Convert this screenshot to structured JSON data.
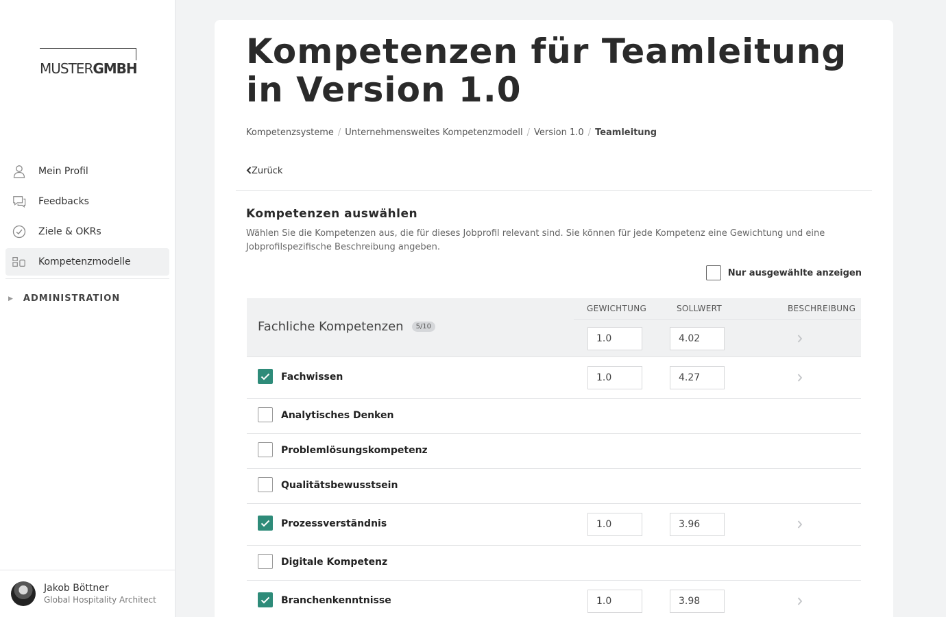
{
  "logo": {
    "part1": "MUSTER",
    "part2": "GMBH"
  },
  "nav": {
    "items": [
      {
        "label": "Mein Profil",
        "icon": "user-icon",
        "active": false
      },
      {
        "label": "Feedbacks",
        "icon": "chat-icon",
        "active": false
      },
      {
        "label": "Ziele & OKRs",
        "icon": "check-circle-icon",
        "active": false
      },
      {
        "label": "Kompetenzmodelle",
        "icon": "model-icon",
        "active": true
      }
    ],
    "admin_label": "ADMINISTRATION"
  },
  "user": {
    "name": "Jakob Böttner",
    "role": "Global Hospitality Architect"
  },
  "page": {
    "title": "Kompetenzen für Teamleitung in Version 1.0",
    "breadcrumb": [
      "Kompetenzsysteme",
      "Unternehmensweites Kompetenzmodell",
      "Version 1.0",
      "Teamleitung"
    ],
    "back_label": "Zurück",
    "section_title": "Kompetenzen auswählen",
    "section_desc": "Wählen Sie die Kompetenzen aus, die für dieses Jobprofil relevant sind. Sie können für jede Kompetenz eine Gewichtung und eine Jobprofilspezifische Beschreibung angeben.",
    "filter_label": "Nur ausgewählte anzeigen"
  },
  "table": {
    "columns": {
      "weight": "GEWICHTUNG",
      "target": "SOLLWERT",
      "desc": "BESCHREIBUNG"
    },
    "group": {
      "name": "Fachliche Kompetenzen",
      "badge": "5/10",
      "weight": "1.0",
      "target": "4.02"
    },
    "rows": [
      {
        "label": "Fachwissen",
        "checked": true,
        "weight": "1.0",
        "target": "4.27"
      },
      {
        "label": "Analytisches Denken",
        "checked": false
      },
      {
        "label": "Problemlösungskompetenz",
        "checked": false
      },
      {
        "label": "Qualitätsbewusstsein",
        "checked": false
      },
      {
        "label": "Prozessverständnis",
        "checked": true,
        "weight": "1.0",
        "target": "3.96"
      },
      {
        "label": "Digitale Kompetenz",
        "checked": false
      },
      {
        "label": "Branchenkenntnisse",
        "checked": true,
        "weight": "1.0",
        "target": "3.98"
      }
    ]
  },
  "colors": {
    "accent": "#2e8b79",
    "background": "#f2f3f4"
  }
}
